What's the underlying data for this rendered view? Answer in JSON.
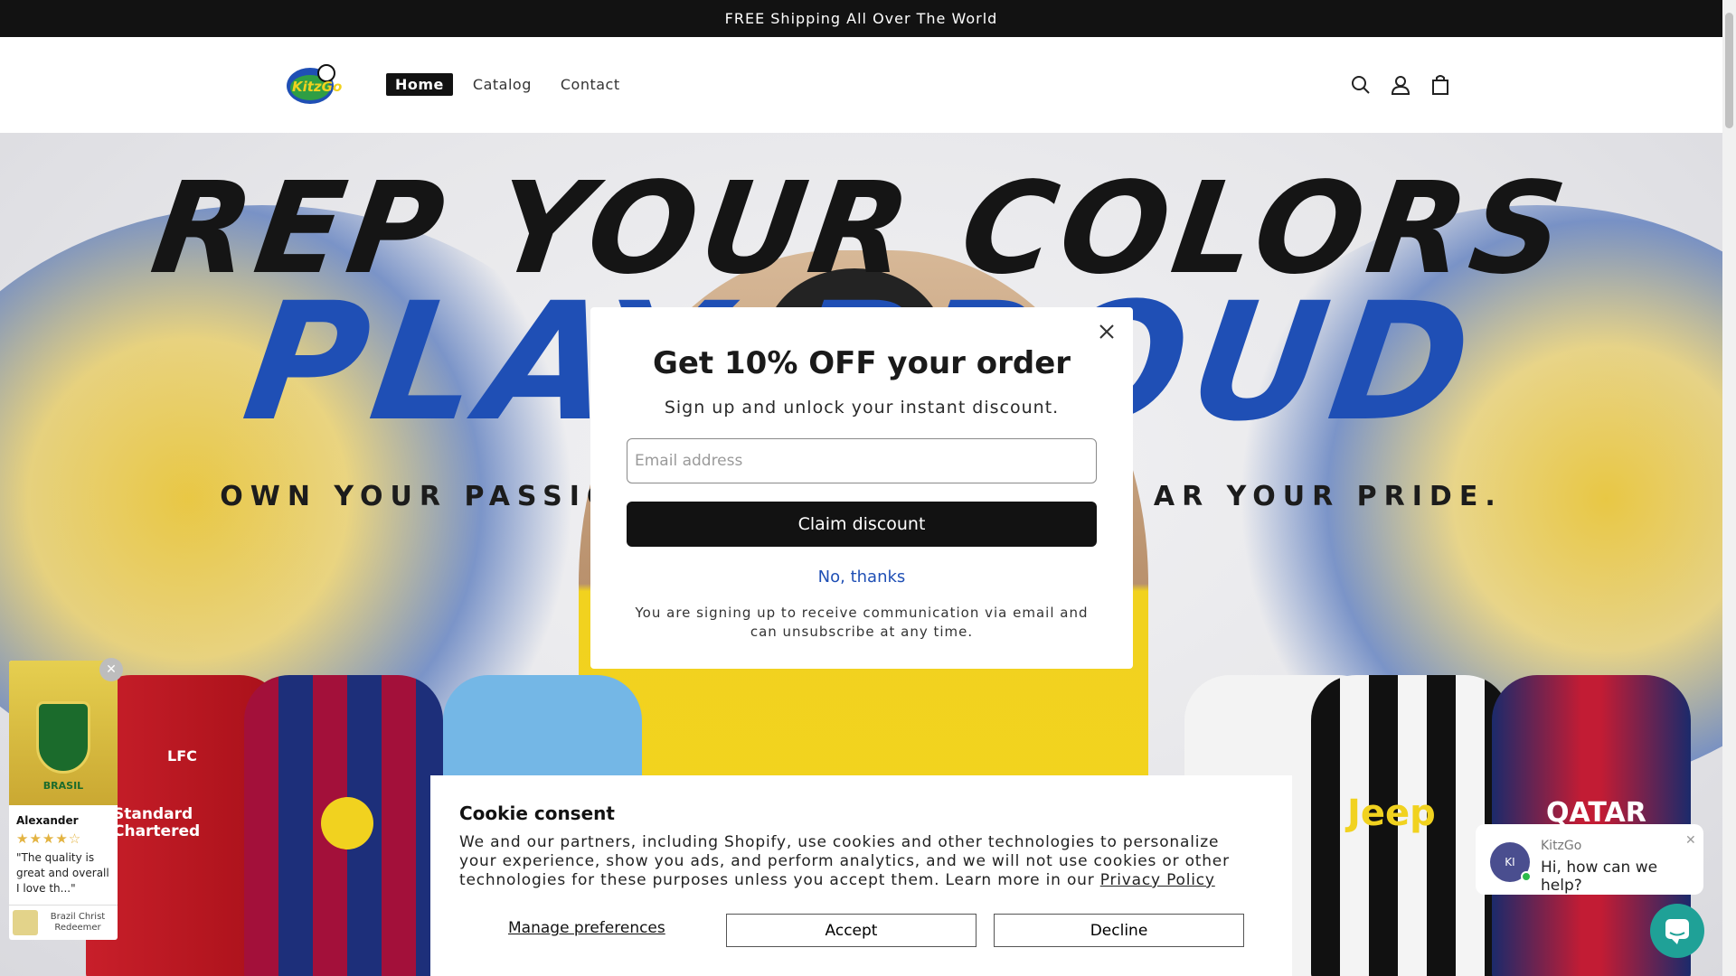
{
  "announcement": {
    "text": "FREE Shipping All Over The World"
  },
  "header": {
    "logo_alt": "KitzGo",
    "nav": [
      {
        "label": "Home",
        "active": true
      },
      {
        "label": "Catalog",
        "active": false
      },
      {
        "label": "Contact",
        "active": false
      }
    ],
    "icons": [
      "search-icon",
      "account-icon",
      "cart-icon"
    ]
  },
  "hero": {
    "headline": "REP YOUR COLORS",
    "headline2": "PLAY PROUD",
    "tagline_left": "OWN YOUR PASSIC",
    "tagline_right": "AR YOUR PRIDE.",
    "sponsors": [
      "LFC",
      "Standard Chartered",
      "Jeep",
      "QATAR"
    ]
  },
  "popup": {
    "title": "Get 10% OFF your order",
    "subtitle": "Sign up and unlock your instant discount.",
    "email_placeholder": "Email address",
    "email_value": "",
    "claim_label": "Claim discount",
    "no_thanks_label": "No, thanks",
    "fine_print": "You are signing up to receive communication via email and can unsubscribe at any time."
  },
  "review": {
    "badge_text": "BRASIL",
    "name": "Alexander",
    "rating": 4,
    "max_rating": 5,
    "text": "\"The quality is great and overall I love th...\"",
    "product": "Brazil Christ Redeemer"
  },
  "cookie": {
    "title": "Cookie consent",
    "text": "We and our partners, including Shopify, use cookies and other technologies to personalize your experience, show you ads, and perform analytics, and we will not use cookies or other technologies for these purposes unless you accept them. Learn more in our ",
    "policy_link": "Privacy Policy",
    "manage_label": "Manage preferences",
    "accept_label": "Accept",
    "decline_label": "Decline"
  },
  "chat": {
    "avatar_initials": "KI",
    "name": "KitzGo",
    "message": "Hi, how can we help?"
  },
  "colors": {
    "accent_dark": "#121212",
    "link_blue": "#1f4fb5",
    "chat_teal": "#1fa197",
    "brazil_yellow": "#f1d21f"
  }
}
